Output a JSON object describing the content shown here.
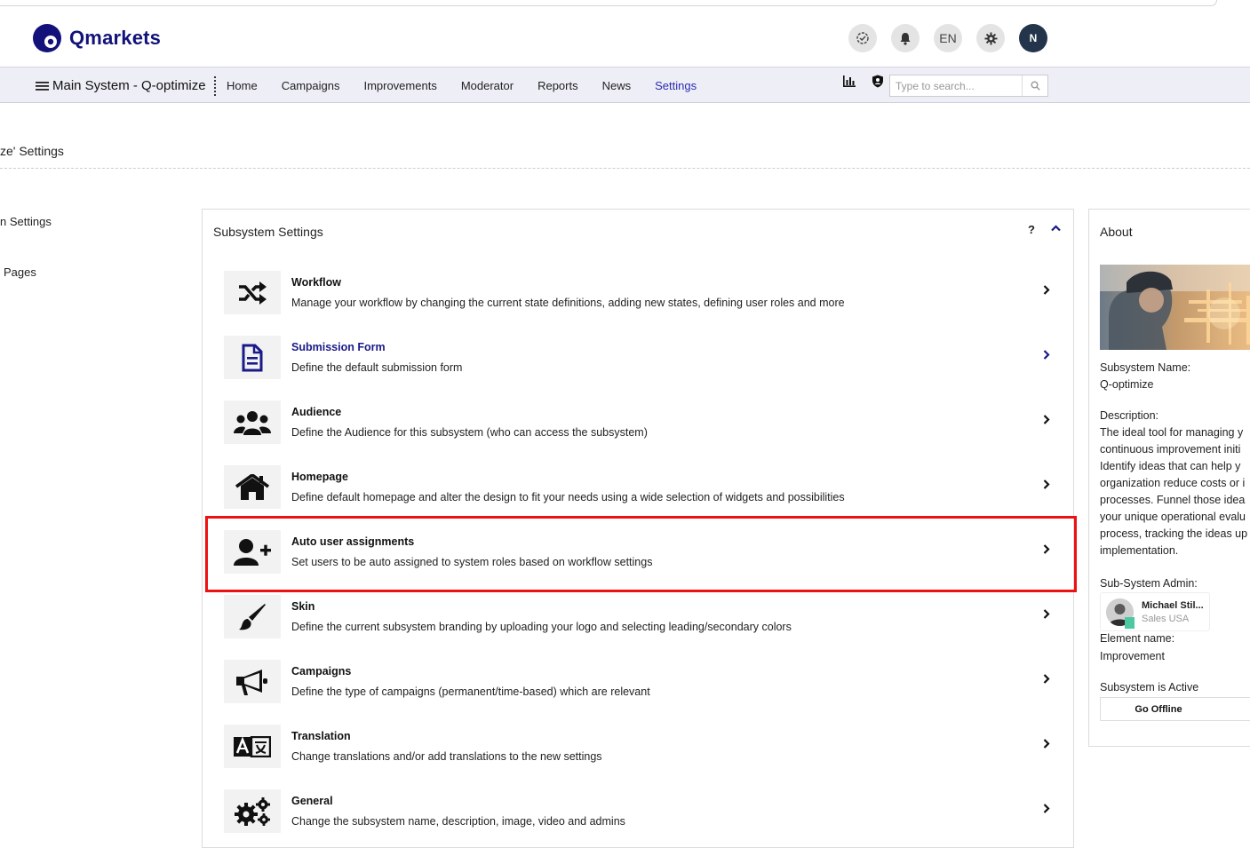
{
  "header": {
    "brand": "Qmarkets",
    "lang_label": "EN",
    "avatar_initial": "N"
  },
  "nav": {
    "system_name": "Main System - Q-optimize",
    "links": [
      "Home",
      "Campaigns",
      "Improvements",
      "Moderator",
      "Reports",
      "News",
      "Settings"
    ],
    "active": "Settings",
    "search_placeholder": "Type to search..."
  },
  "page": {
    "title": "ze' Settings",
    "left_nav": [
      "n Settings",
      "Pages"
    ]
  },
  "panel": {
    "title": "Subsystem Settings",
    "help": "?",
    "items": [
      {
        "icon": "shuffle-icon",
        "title": "Workflow",
        "desc": "Manage your workflow by changing the current state definitions, adding new states, defining user roles and more"
      },
      {
        "icon": "document-icon",
        "title": "Submission Form",
        "desc": "Define the default submission form"
      },
      {
        "icon": "users-icon",
        "title": "Audience",
        "desc": "Define the Audience for this subsystem (who can access the subsystem)"
      },
      {
        "icon": "home-icon",
        "title": "Homepage",
        "desc": "Define default homepage and alter the design to fit your needs using a wide selection of widgets and possibilities"
      },
      {
        "icon": "user-plus-icon",
        "title": "Auto user assignments",
        "desc": "Set users to be auto assigned to system roles based on workflow settings"
      },
      {
        "icon": "paintbrush-icon",
        "title": "Skin",
        "desc": "Define the current subsystem branding by uploading your logo and selecting leading/secondary colors"
      },
      {
        "icon": "megaphone-icon",
        "title": "Campaigns",
        "desc": "Define the type of campaigns (permanent/time-based) which are relevant"
      },
      {
        "icon": "translate-icon",
        "title": "Translation",
        "desc": "Change translations and/or add translations to the new settings"
      },
      {
        "icon": "gears-icon",
        "title": "General",
        "desc": "Change the subsystem name, description, image, video and admins"
      }
    ]
  },
  "about": {
    "title": "About",
    "name_label": "Subsystem Name:",
    "name_value": "Q-optimize",
    "desc_label": "Description:",
    "desc_lines": [
      "The ideal tool for managing y",
      "continuous improvement initi",
      "Identify ideas that can help y",
      "organization reduce costs or i",
      "processes. Funnel those idea",
      "your unique operational evalu",
      "process, tracking the ideas up",
      "implementation."
    ],
    "admin_label": "Sub-System Admin:",
    "admin_name": "Michael Stil...",
    "admin_role": "Sales USA",
    "element_label": "Element name:",
    "element_value": "Improvement",
    "status_label": "Subsystem is Active",
    "offline_button": "Go Offline"
  },
  "colors": {
    "brand": "#12127a",
    "nav_bg": "#eeeef7",
    "highlight": "#ee1111"
  }
}
